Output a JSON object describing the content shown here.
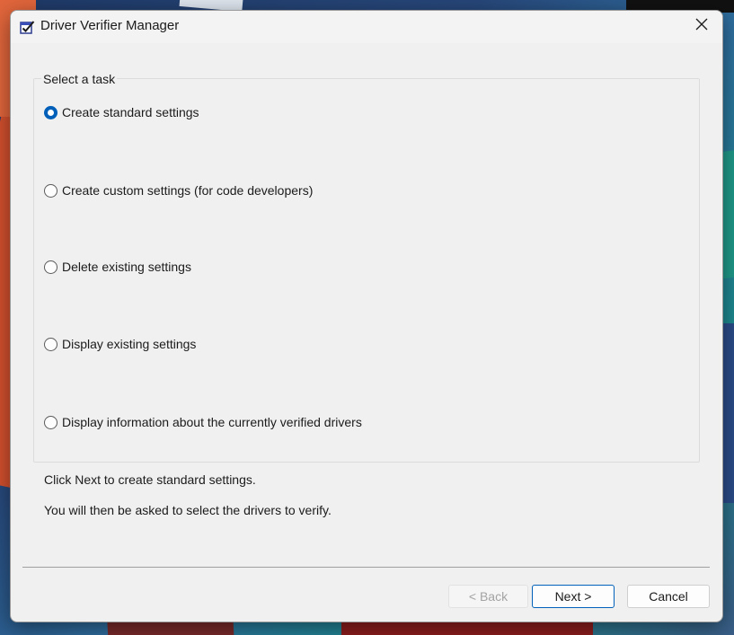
{
  "window": {
    "title": "Driver Verifier Manager",
    "close_icon": "close-icon",
    "app_icon": "checklist-icon"
  },
  "task_group": {
    "legend": "Select a task",
    "options": [
      {
        "label": "Create standard settings",
        "checked": true
      },
      {
        "label": "Create custom settings (for code developers)",
        "checked": false
      },
      {
        "label": "Delete existing settings",
        "checked": false
      },
      {
        "label": "Display existing settings",
        "checked": false
      },
      {
        "label": "Display information about the currently verified drivers",
        "checked": false
      }
    ]
  },
  "description": {
    "line1": "Click Next to create standard settings.",
    "line2": "You will then be asked to select the drivers to verify."
  },
  "buttons": {
    "back": "< Back",
    "next": "Next >",
    "cancel": "Cancel"
  },
  "colors": {
    "accent": "#005fb8",
    "window_bg": "#f0f0f0",
    "disabled_text": "#a3a3a3"
  }
}
